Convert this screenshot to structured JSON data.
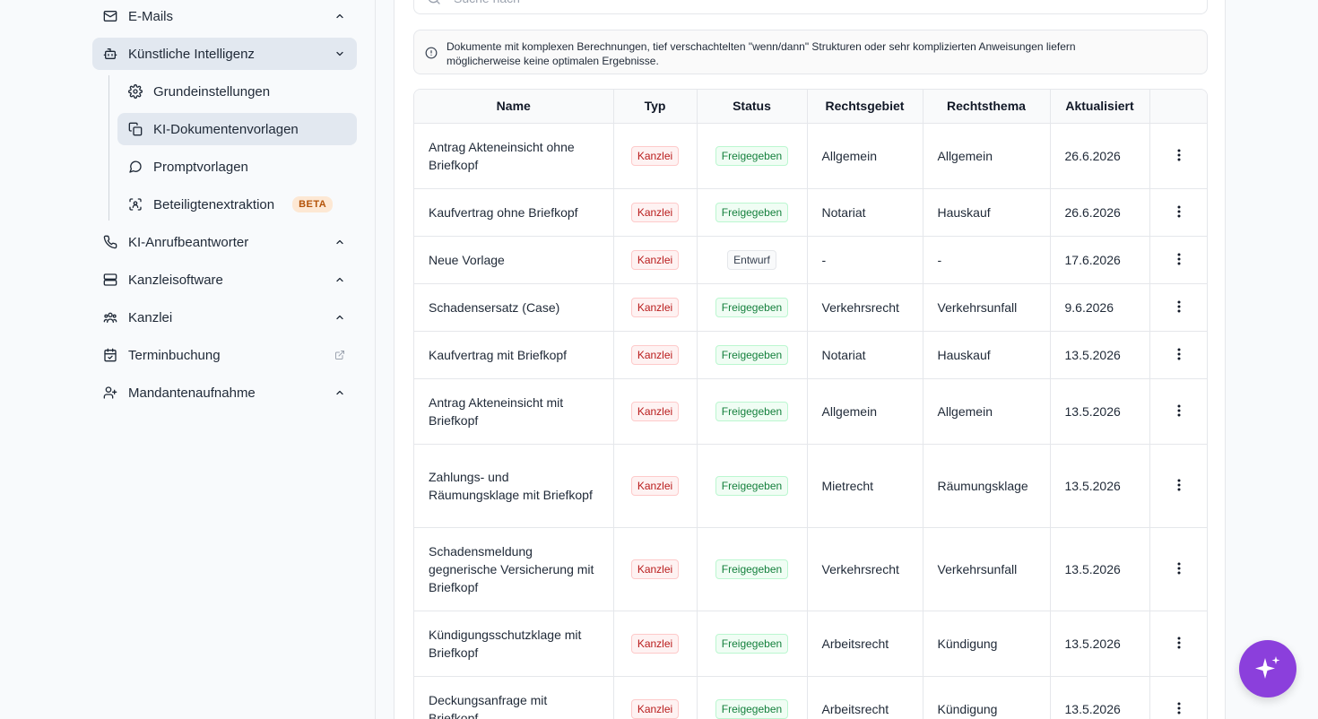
{
  "sidebar": {
    "items": [
      {
        "label": "E-Mails",
        "icon": "mail-icon"
      },
      {
        "label": "Künstliche Intelligenz",
        "icon": "bot-icon"
      },
      {
        "label": "KI-Anrufbeantworter",
        "icon": "phone-icon"
      },
      {
        "label": "Kanzleisoftware",
        "icon": "server-icon"
      },
      {
        "label": "Kanzlei",
        "icon": "users-icon"
      },
      {
        "label": "Terminbuchung",
        "icon": "calendar-check-icon"
      },
      {
        "label": "Mandantenaufnahme",
        "icon": "user-plus-icon"
      }
    ],
    "sub_items": [
      {
        "label": "Grundeinstellungen",
        "icon": "gear-icon"
      },
      {
        "label": "KI-Dokumentenvorlagen",
        "icon": "copy-icon"
      },
      {
        "label": "Promptvorlagen",
        "icon": "message-circle-icon"
      },
      {
        "label": "Beteiligtenextraktion",
        "icon": "scan-user-icon",
        "badge": "BETA"
      }
    ]
  },
  "search": {
    "placeholder": "Suche nach"
  },
  "notice": {
    "text": "Dokumente mit komplexen Berechnungen, tief verschachtelten \"wenn/dann\" Strukturen oder sehr komplizierten Anweisungen liefern möglicherweise keine optimalen Ergebnisse."
  },
  "table": {
    "headers": [
      "Name",
      "Typ",
      "Status",
      "Rechtsgebiet",
      "Rechtsthema",
      "Aktualisiert"
    ],
    "rows": [
      {
        "name": "Antrag Akteneinsicht ohne Briefkopf",
        "typ": "Kanzlei",
        "status": "Freigegeben",
        "gebiet": "Allgemein",
        "thema": "Allgemein",
        "datum": "26.6.2026"
      },
      {
        "name": "Kaufvertrag ohne Briefkopf",
        "typ": "Kanzlei",
        "status": "Freigegeben",
        "gebiet": "Notariat",
        "thema": "Hauskauf",
        "datum": "26.6.2026"
      },
      {
        "name": "Neue Vorlage",
        "typ": "Kanzlei",
        "status": "Entwurf",
        "gebiet": "-",
        "thema": "-",
        "datum": "17.6.2026"
      },
      {
        "name": "Schadensersatz (Case)",
        "typ": "Kanzlei",
        "status": "Freigegeben",
        "gebiet": "Verkehrsrecht",
        "thema": "Verkehrsunfall",
        "datum": "9.6.2026"
      },
      {
        "name": "Kaufvertrag mit Briefkopf",
        "typ": "Kanzlei",
        "status": "Freigegeben",
        "gebiet": "Notariat",
        "thema": "Hauskauf",
        "datum": "13.5.2026"
      },
      {
        "name": "Antrag Akteneinsicht mit Briefkopf",
        "typ": "Kanzlei",
        "status": "Freigegeben",
        "gebiet": "Allgemein",
        "thema": "Allgemein",
        "datum": "13.5.2026"
      },
      {
        "name": "Zahlungs- und Räumungsklage mit Briefkopf",
        "typ": "Kanzlei",
        "status": "Freigegeben",
        "gebiet": "Mietrecht",
        "thema": "Räumungsklage",
        "datum": "13.5.2026"
      },
      {
        "name": "Schadensmeldung gegnerische Versicherung mit Briefkopf",
        "typ": "Kanzlei",
        "status": "Freigegeben",
        "gebiet": "Verkehrsrecht",
        "thema": "Verkehrsunfall",
        "datum": "13.5.2026"
      },
      {
        "name": "Kündigungsschutzklage mit Briefkopf",
        "typ": "Kanzlei",
        "status": "Freigegeben",
        "gebiet": "Arbeitsrecht",
        "thema": "Kündigung",
        "datum": "13.5.2026"
      },
      {
        "name": "Deckungsanfrage mit Briefkopf",
        "typ": "Kanzlei",
        "status": "Freigegeben",
        "gebiet": "Arbeitsrecht",
        "thema": "Kündigung",
        "datum": "13.5.2026"
      }
    ]
  },
  "fab": {
    "icon": "sparkles-icon"
  },
  "colors": {
    "accent": "#8b3fdc",
    "active_bg": "#e2e8f0",
    "kanzlei": "#b91c1c",
    "freigegeben": "#15803d"
  }
}
